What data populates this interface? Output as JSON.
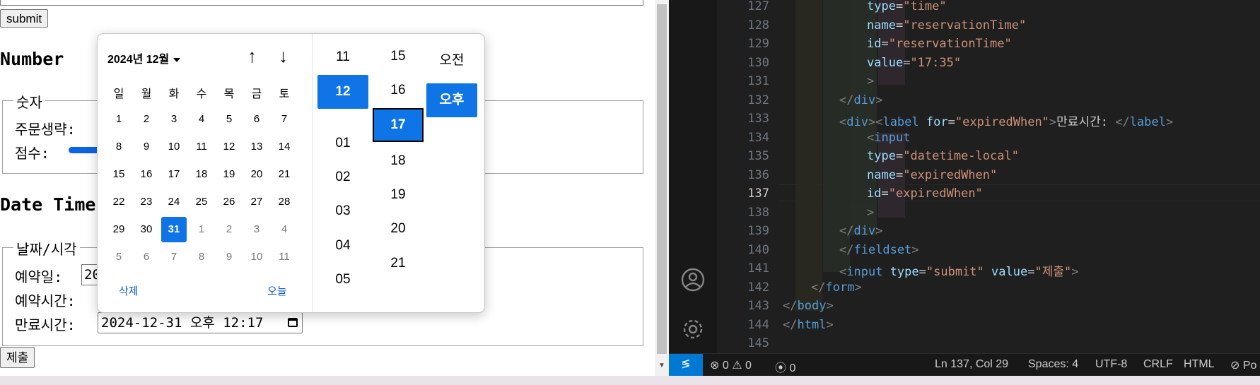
{
  "browser": {
    "submit_label": "submit",
    "number_heading": "Number",
    "number_legend": "숫자",
    "field_order_label": "주문생략:",
    "field_score_label": "점수:",
    "datetime_heading": "Date Time",
    "datetime_legend": "날짜/시각",
    "reservation_date_label": "예약일:",
    "reservation_date_value": "20",
    "reservation_time_label": "예약시간:",
    "expiry_label": "만료시간:",
    "expiry_value": "2024-12-31 오후 12:17",
    "submit_korean_label": "제출"
  },
  "picker": {
    "month_label": "2024년 12월",
    "up_glyph": "↑",
    "down_glyph": "↓",
    "weekdays": [
      "일",
      "월",
      "화",
      "수",
      "목",
      "금",
      "토"
    ],
    "days": [
      "1",
      "2",
      "3",
      "4",
      "5",
      "6",
      "7",
      "8",
      "9",
      "10",
      "11",
      "12",
      "13",
      "14",
      "15",
      "16",
      "17",
      "18",
      "19",
      "20",
      "21",
      "22",
      "23",
      "24",
      "25",
      "26",
      "27",
      "28",
      "29",
      "30",
      "31",
      "1",
      "2",
      "3",
      "4",
      "5",
      "6",
      "7",
      "8",
      "9",
      "10",
      "11"
    ],
    "selected_day": "31",
    "clear_label": "삭제",
    "today_label": "오늘",
    "hours": [
      "11",
      "12",
      "01",
      "02",
      "03",
      "04",
      "05"
    ],
    "selected_hour": "12",
    "minutes": [
      "15",
      "16",
      "17",
      "18",
      "19",
      "20",
      "21"
    ],
    "selected_minute": "17",
    "ampm": [
      "오전",
      "오후"
    ],
    "selected_ampm": "오후"
  },
  "editor": {
    "line_numbers": [
      "127",
      "128",
      "129",
      "130",
      "131",
      "132",
      "133",
      "134",
      "135",
      "136",
      "137",
      "138",
      "139",
      "140",
      "141",
      "142",
      "143",
      "144",
      "145"
    ],
    "current_line": "137",
    "status": {
      "errors": "0",
      "warnings": "0",
      "ports": "0",
      "position": "Ln 137, Col 29",
      "spaces": "Spaces: 4",
      "encoding": "UTF-8",
      "eol": "CRLF",
      "language": "HTML",
      "notifications": "Po"
    },
    "colors": {
      "tag": "#569cd6",
      "attr": "#9cdcfe",
      "string": "#ce9178",
      "bracket": "#808080",
      "text": "#cccccc"
    }
  }
}
